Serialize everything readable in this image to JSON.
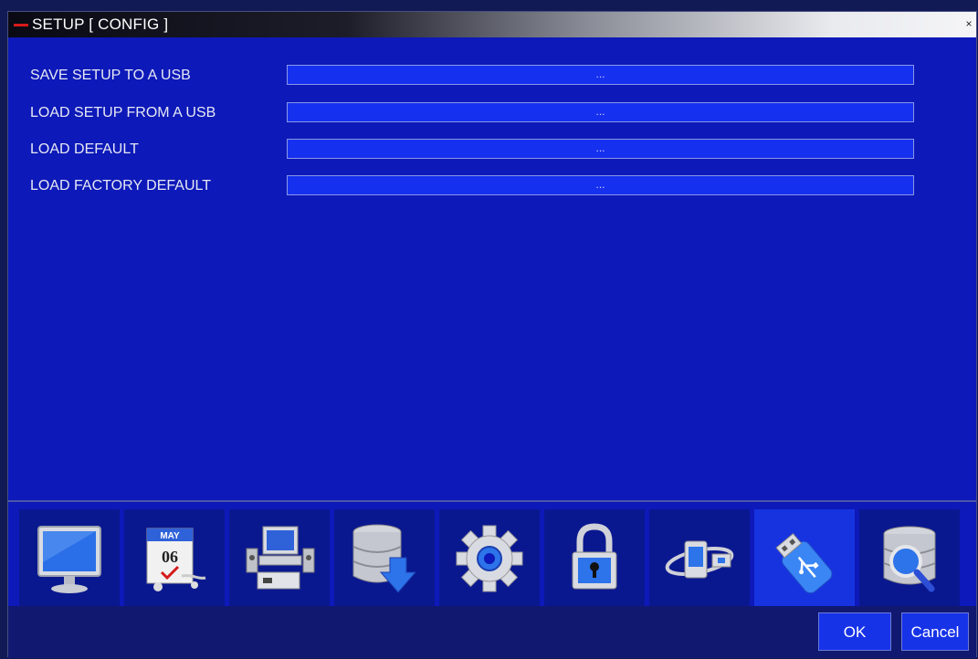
{
  "window": {
    "title": "SETUP [ CONFIG ]",
    "close_glyph": "×"
  },
  "rows": [
    {
      "label": "SAVE SETUP TO A USB",
      "button": "..."
    },
    {
      "label": "LOAD SETUP FROM A USB",
      "button": "..."
    },
    {
      "label": "LOAD DEFAULT",
      "button": "..."
    },
    {
      "label": "LOAD FACTORY DEFAULT",
      "button": "..."
    }
  ],
  "iconbar": {
    "items": [
      {
        "icon": "monitor-icon"
      },
      {
        "icon": "calendar-icon",
        "month": "MAY",
        "day": "06"
      },
      {
        "icon": "computer-devices-icon"
      },
      {
        "icon": "database-download-icon"
      },
      {
        "icon": "gear-icon"
      },
      {
        "icon": "padlock-icon"
      },
      {
        "icon": "network-icon"
      },
      {
        "icon": "usb-drive-icon",
        "selected": true
      },
      {
        "icon": "database-search-icon"
      }
    ]
  },
  "buttons": {
    "ok": "OK",
    "cancel": "Cancel"
  },
  "colors": {
    "background": "#0d19b8",
    "field": "#1630f0",
    "active_tool": "#1733e0",
    "accent_red": "#d61b1b"
  }
}
